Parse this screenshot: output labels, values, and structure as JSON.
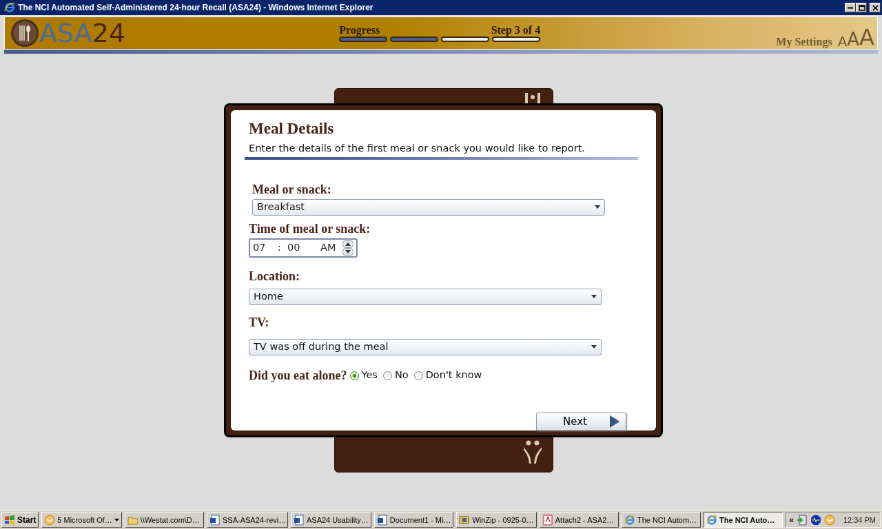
{
  "window": {
    "title": "The NCI Automated Self-Administered 24-hour Recall (ASA24) - Windows Internet Explorer"
  },
  "header": {
    "logo_part_1": "ASA",
    "logo_part_2": "24",
    "progress_label": "Progress",
    "step": "Step 3 of 4",
    "progress": [
      {
        "done": true
      },
      {
        "done": true
      },
      {
        "done": false
      },
      {
        "done": false
      }
    ],
    "settings_link": "My Settings",
    "text_sizes": [
      "A",
      "A",
      "A"
    ]
  },
  "dialog": {
    "title": "Meal Details",
    "subtitle": "Enter the details of the first meal or snack you would like to report.",
    "meal": {
      "label": "Meal or snack:",
      "value": "Breakfast"
    },
    "time": {
      "label": "Time of meal or snack:",
      "hour": "07",
      "separator": ":",
      "minute": "00",
      "period": "AM"
    },
    "location": {
      "label": "Location:",
      "value": "Home"
    },
    "tv": {
      "label": "TV:",
      "value": "TV was off during the meal"
    },
    "alone": {
      "label": "Did you eat alone?",
      "options": [
        {
          "label": "Yes",
          "selected": true
        },
        {
          "label": "No",
          "selected": false
        },
        {
          "label": "Don't know",
          "selected": false
        }
      ]
    },
    "next_button": "Next"
  },
  "taskbar": {
    "start": "Start",
    "items": [
      {
        "kind": "mail",
        "label": "5 Microsoft Of…",
        "selected": false,
        "menu": true
      },
      {
        "kind": "folder",
        "label": "\\\\Westat.com\\D…",
        "selected": false
      },
      {
        "kind": "word",
        "label": "SSA-ASA24-revi…",
        "selected": false
      },
      {
        "kind": "word",
        "label": "ASA24 Usability…",
        "selected": false
      },
      {
        "kind": "word",
        "label": "Document1 - Mi…",
        "selected": false
      },
      {
        "kind": "zip",
        "label": "WinZip - 0925-0…",
        "selected": false
      },
      {
        "kind": "pdf",
        "label": "Attach2 - ASA2…",
        "selected": false
      },
      {
        "kind": "browser",
        "label": "The NCI Autom…",
        "selected": false
      },
      {
        "kind": "browser",
        "label": "The NCI Auto…",
        "selected": true
      }
    ],
    "tray_toggle": "«",
    "clock": "12:34 PM"
  }
}
